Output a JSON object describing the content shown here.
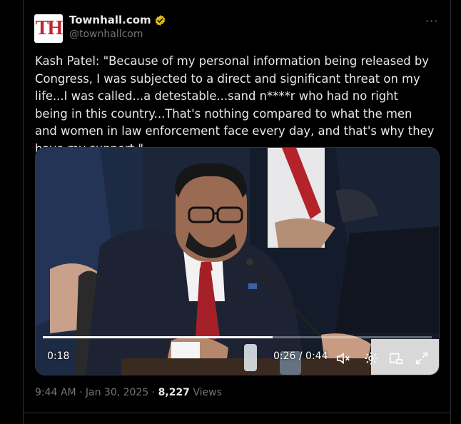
{
  "author": {
    "display_name": "Townhall.com",
    "handle": "@townhall.com",
    "handle_shown": "@townhallcom",
    "avatar_text": "TH",
    "verified": true,
    "avatar_color": "#c0262d"
  },
  "tweet": {
    "text": "Kash Patel: \"Because of my personal information being released by Congress, I was subjected to a direct and significant threat on my life...I was called...a detestable...sand n****r who had no right being in this country...That's nothing compared to what the men and women in law enforcement face every day, and that's why they have my support.\""
  },
  "video": {
    "elapsed": "0:26",
    "duration": "0:44",
    "time_display": "0:26 / 0:44",
    "left_time": "0:18",
    "progress": 0.59,
    "controls": [
      "mute-icon",
      "settings-gear-icon",
      "pip-icon",
      "fullscreen-icon"
    ]
  },
  "meta": {
    "time": "9:44 AM",
    "separator": " · ",
    "date": "Jan 30, 2025",
    "views_count": "8,227",
    "views_label": " Views"
  },
  "menu": {
    "more_label": "···"
  }
}
